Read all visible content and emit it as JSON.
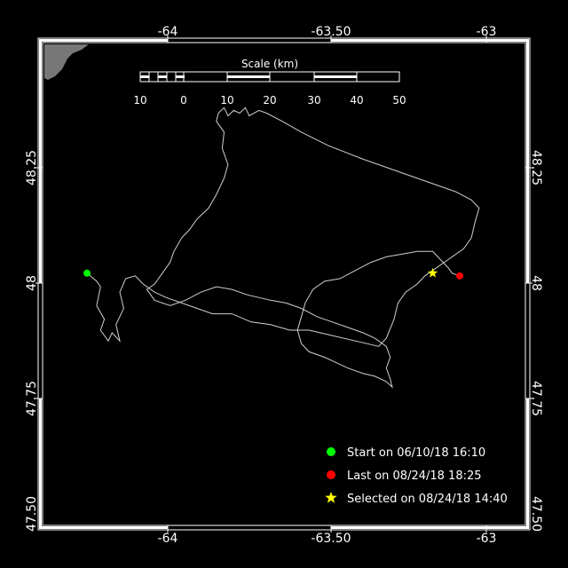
{
  "map": {
    "lon_labels": [
      "-64",
      "-63.50",
      "-63"
    ],
    "lat_labels": [
      "48.25",
      "48",
      "47.75",
      "47.50"
    ],
    "lon_range": [
      -64.19,
      -62.94
    ],
    "lat_range": [
      47.5,
      48.39
    ]
  },
  "scale_bar": {
    "title": "Scale (km)",
    "labels": [
      "10",
      "0",
      "10",
      "20",
      "30",
      "40",
      "50"
    ]
  },
  "track": {
    "points": [
      [
        -64.075,
        47.965
      ],
      [
        -64.05,
        47.95
      ],
      [
        -64.04,
        47.94
      ],
      [
        -64.05,
        47.905
      ],
      [
        -64.03,
        47.88
      ],
      [
        -64.04,
        47.86
      ],
      [
        -64.02,
        47.84
      ],
      [
        -64.01,
        47.855
      ],
      [
        -63.99,
        47.84
      ],
      [
        -64.0,
        47.87
      ],
      [
        -63.98,
        47.9
      ],
      [
        -63.99,
        47.93
      ],
      [
        -63.975,
        47.955
      ],
      [
        -63.95,
        47.96
      ],
      [
        -63.93,
        47.945
      ],
      [
        -63.9,
        47.93
      ],
      [
        -63.87,
        47.92
      ],
      [
        -63.83,
        47.91
      ],
      [
        -63.79,
        47.9
      ],
      [
        -63.75,
        47.89
      ],
      [
        -63.7,
        47.89
      ],
      [
        -63.65,
        47.875
      ],
      [
        -63.6,
        47.87
      ],
      [
        -63.55,
        47.86
      ],
      [
        -63.5,
        47.86
      ],
      [
        -63.44,
        47.85
      ],
      [
        -63.38,
        47.84
      ],
      [
        -63.35,
        47.835
      ],
      [
        -63.32,
        47.83
      ],
      [
        -63.3,
        47.845
      ],
      [
        -63.28,
        47.88
      ],
      [
        -63.27,
        47.91
      ],
      [
        -63.25,
        47.93
      ],
      [
        -63.22,
        47.945
      ],
      [
        -63.2,
        47.96
      ],
      [
        -63.17,
        47.975
      ],
      [
        -63.14,
        47.99
      ],
      [
        -63.1,
        48.01
      ],
      [
        -63.08,
        48.03
      ],
      [
        -63.07,
        48.06
      ],
      [
        -63.06,
        48.085
      ],
      [
        -63.08,
        48.1
      ],
      [
        -63.12,
        48.115
      ],
      [
        -63.2,
        48.135
      ],
      [
        -63.28,
        48.155
      ],
      [
        -63.36,
        48.175
      ],
      [
        -63.45,
        48.2
      ],
      [
        -63.52,
        48.225
      ],
      [
        -63.57,
        48.245
      ],
      [
        -63.61,
        48.26
      ],
      [
        -63.63,
        48.265
      ],
      [
        -63.655,
        48.255
      ],
      [
        -63.665,
        48.27
      ],
      [
        -63.68,
        48.26
      ],
      [
        -63.695,
        48.265
      ],
      [
        -63.71,
        48.255
      ],
      [
        -63.72,
        48.27
      ],
      [
        -63.735,
        48.26
      ],
      [
        -63.74,
        48.245
      ],
      [
        -63.72,
        48.225
      ],
      [
        -63.725,
        48.195
      ],
      [
        -63.71,
        48.165
      ],
      [
        -63.72,
        48.14
      ],
      [
        -63.74,
        48.11
      ],
      [
        -63.76,
        48.085
      ],
      [
        -63.79,
        48.065
      ],
      [
        -63.81,
        48.045
      ],
      [
        -63.83,
        48.03
      ],
      [
        -63.85,
        48.005
      ],
      [
        -63.86,
        47.985
      ],
      [
        -63.88,
        47.965
      ],
      [
        -63.9,
        47.945
      ],
      [
        -63.92,
        47.935
      ],
      [
        -63.9,
        47.915
      ],
      [
        -63.86,
        47.905
      ],
      [
        -63.82,
        47.915
      ],
      [
        -63.78,
        47.93
      ],
      [
        -63.74,
        47.94
      ],
      [
        -63.7,
        47.935
      ],
      [
        -63.66,
        47.925
      ],
      [
        -63.6,
        47.915
      ],
      [
        -63.56,
        47.91
      ],
      [
        -63.52,
        47.9
      ],
      [
        -63.48,
        47.885
      ],
      [
        -63.44,
        47.875
      ],
      [
        -63.4,
        47.865
      ],
      [
        -63.36,
        47.855
      ],
      [
        -63.33,
        47.845
      ],
      [
        -63.3,
        47.83
      ],
      [
        -63.29,
        47.81
      ],
      [
        -63.3,
        47.79
      ],
      [
        -63.29,
        47.77
      ],
      [
        -63.285,
        47.755
      ],
      [
        -63.3,
        47.765
      ],
      [
        -63.33,
        47.775
      ],
      [
        -63.36,
        47.78
      ],
      [
        -63.4,
        47.79
      ],
      [
        -63.43,
        47.8
      ],
      [
        -63.46,
        47.81
      ],
      [
        -63.5,
        47.82
      ],
      [
        -63.52,
        47.835
      ],
      [
        -63.53,
        47.86
      ],
      [
        -63.52,
        47.885
      ],
      [
        -63.51,
        47.91
      ],
      [
        -63.49,
        47.935
      ],
      [
        -63.46,
        47.95
      ],
      [
        -63.42,
        47.955
      ],
      [
        -63.38,
        47.97
      ],
      [
        -63.34,
        47.985
      ],
      [
        -63.3,
        47.995
      ],
      [
        -63.26,
        48.0
      ],
      [
        -63.22,
        48.005
      ],
      [
        -63.18,
        48.005
      ],
      [
        -63.16,
        47.99
      ],
      [
        -63.14,
        47.975
      ],
      [
        -63.13,
        47.965
      ],
      [
        -63.11,
        47.96
      ]
    ]
  },
  "markers": {
    "start": {
      "lon": -64.075,
      "lat": 47.965,
      "color": "#00ff00"
    },
    "last": {
      "lon": -63.11,
      "lat": 47.96,
      "color": "#ff0000"
    },
    "selected": {
      "lon": -63.18,
      "lat": 47.965,
      "color": "#ffff00"
    }
  },
  "legend": {
    "start": "Start on 06/10/18 16:10",
    "last": "Last on 08/24/18 18:25",
    "selected": "Selected on 08/24/18 14:40"
  }
}
